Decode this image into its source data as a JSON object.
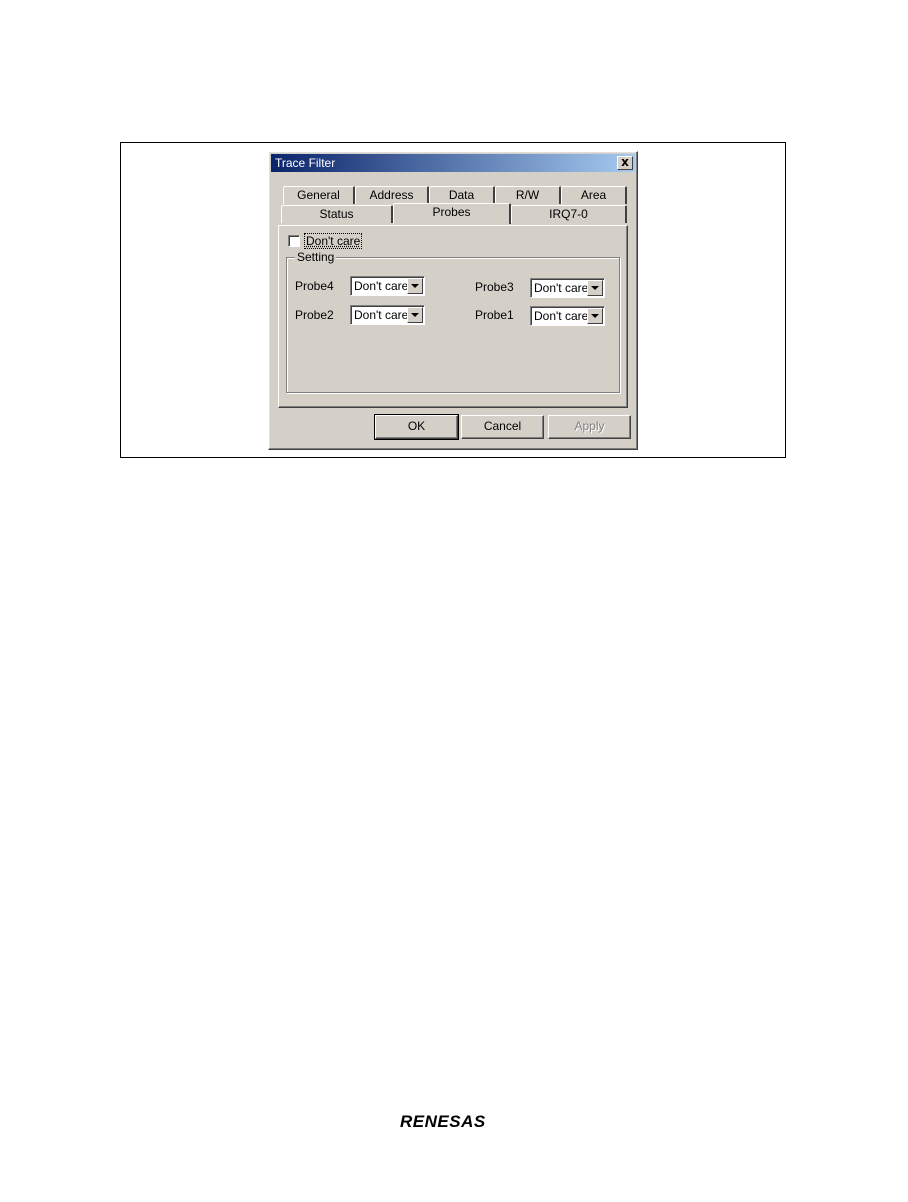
{
  "dialog": {
    "title": "Trace Filter",
    "close_glyph": "x",
    "tabs_row1": [
      "General",
      "Address",
      "Data",
      "R/W",
      "Area"
    ],
    "tabs_row2": [
      "Status",
      "Probes",
      "IRQ7-0"
    ],
    "active_tab": "Probes",
    "dont_care_checkbox": {
      "label": "Don't care",
      "checked": false
    },
    "setting_group": {
      "title": "Setting",
      "probes": [
        {
          "label": "Probe4",
          "value": "Don't care"
        },
        {
          "label": "Probe3",
          "value": "Don't care"
        },
        {
          "label": "Probe2",
          "value": "Don't care"
        },
        {
          "label": "Probe1",
          "value": "Don't care"
        }
      ]
    },
    "buttons": {
      "ok": "OK",
      "cancel": "Cancel",
      "apply": "Apply"
    }
  },
  "footer": {
    "logo_text": "RENESAS"
  }
}
